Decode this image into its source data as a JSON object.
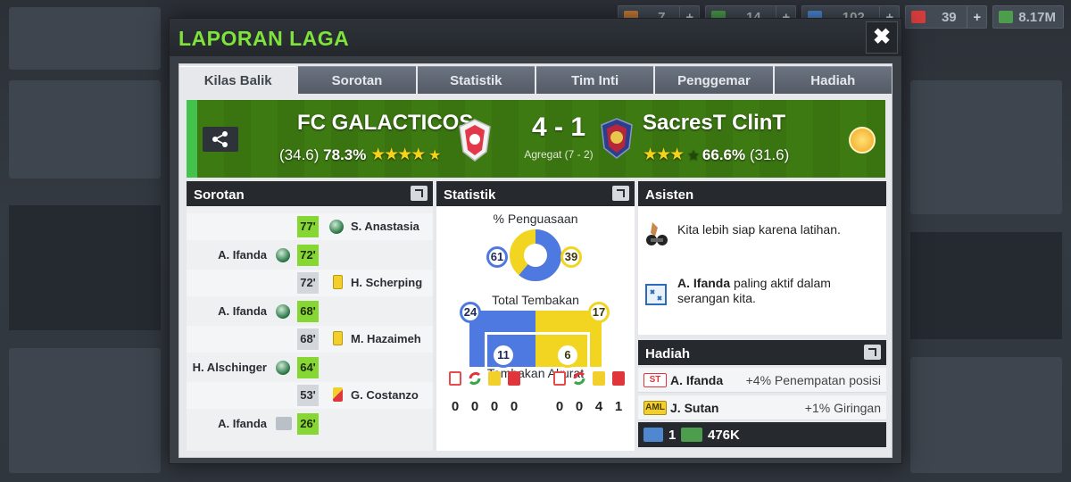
{
  "topbar": {
    "resources": [
      {
        "icon": "ticket-icon",
        "value": "7",
        "color": "#c97d3a"
      },
      {
        "icon": "money-icon",
        "value": "14",
        "color": "#4c9e4c"
      },
      {
        "icon": "energy-icon",
        "value": "102",
        "color": "#4d88d1"
      },
      {
        "icon": "medkit-icon",
        "value": "39",
        "color": "#d63c3c"
      },
      {
        "icon": "cash-icon",
        "value": "8.17M",
        "color": "#4c9e4c"
      }
    ],
    "plus": "+"
  },
  "modal": {
    "title": "LAPORAN LAGA",
    "close": "✖"
  },
  "tabs": [
    "Kilas Balik",
    "Sorotan",
    "Statistik",
    "Tim Inti",
    "Penggemar",
    "Hadiah"
  ],
  "match": {
    "home": {
      "name": "FC GALACTICOS",
      "value": "(34.6)",
      "pct": "78.3%",
      "stars": "★★★★",
      "half_star": "★"
    },
    "score": "4 - 1",
    "aggregate": "Agregat (7 - 2)",
    "away": {
      "name": "SacresT ClinT",
      "value": "(31.6)",
      "pct": "66.6%",
      "stars": "★★★",
      "dim_star": "★"
    }
  },
  "sorotan": {
    "title": "Sorotan",
    "events": [
      {
        "minute": "77'",
        "side": "away",
        "type": "goal",
        "player": "S. Anastasia",
        "highlight": true
      },
      {
        "minute": "72'",
        "side": "home",
        "type": "goal",
        "player": "A. Ifanda",
        "highlight": true
      },
      {
        "minute": "72'",
        "side": "away",
        "type": "yellow",
        "player": "H. Scherping",
        "highlight": false
      },
      {
        "minute": "68'",
        "side": "home",
        "type": "goal",
        "player": "A. Ifanda",
        "highlight": true
      },
      {
        "minute": "68'",
        "side": "away",
        "type": "yellow",
        "player": "M. Hazaimeh",
        "highlight": false
      },
      {
        "minute": "64'",
        "side": "home",
        "type": "goal",
        "player": "H. Alschinger",
        "highlight": true
      },
      {
        "minute": "53'",
        "side": "away",
        "type": "red",
        "player": "G. Costanzo",
        "highlight": false
      },
      {
        "minute": "26'",
        "side": "home",
        "type": "penalty",
        "player": "A. Ifanda",
        "highlight": true
      }
    ]
  },
  "statistik": {
    "title": "Statistik",
    "possession_label": "% Penguasaan",
    "possession": {
      "home": "61",
      "away": "39"
    },
    "shots_label": "Total Tembakan",
    "shots": {
      "home": "24",
      "away": "17"
    },
    "on_target": {
      "home": "11",
      "away": "6"
    },
    "on_target_label": "Tembakan Akurat",
    "counts_home": [
      "0",
      "0",
      "0",
      "0"
    ],
    "counts_away": [
      "0",
      "0",
      "4",
      "1"
    ]
  },
  "asisten": {
    "title": "Asisten",
    "note1": "Kita lebih siap karena latihan.",
    "note2_name": "A. Ifanda",
    "note2_line1": " paling aktif dalam",
    "note2_line2": "serangan kita."
  },
  "hadiah": {
    "title": "Hadiah",
    "rows": [
      {
        "pos": "ST",
        "name": "A. Ifanda",
        "bonus": "+4% Penempatan posisi",
        "color": "#e0353b"
      },
      {
        "pos": "AML",
        "name": "J. Sutan",
        "bonus": "+1% Giringan",
        "color": "#f2cf2b"
      }
    ],
    "energy": "1",
    "money": "476K"
  },
  "colors": {
    "accent_green": "#7ee33a",
    "home_blue": "#4d79e0",
    "away_yellow": "#f2d520"
  }
}
